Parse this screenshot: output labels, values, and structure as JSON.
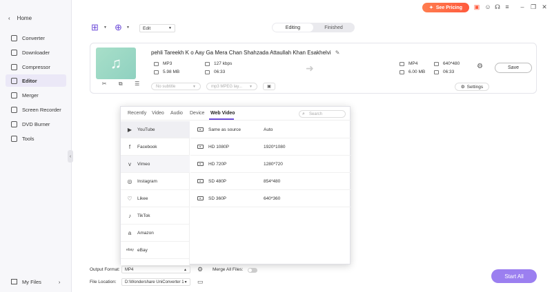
{
  "sidebar": {
    "home_label": "Home",
    "items": [
      {
        "label": "Converter",
        "icon": "converter-icon"
      },
      {
        "label": "Downloader",
        "icon": "downloader-icon"
      },
      {
        "label": "Compressor",
        "icon": "compressor-icon"
      },
      {
        "label": "Editor",
        "icon": "editor-icon"
      },
      {
        "label": "Merger",
        "icon": "merger-icon"
      },
      {
        "label": "Screen Recorder",
        "icon": "screen-recorder-icon"
      },
      {
        "label": "DVD Burner",
        "icon": "dvd-burner-icon"
      },
      {
        "label": "Tools",
        "icon": "tools-icon"
      }
    ],
    "active_item": "Editor",
    "my_files_label": "My Files"
  },
  "topbar": {
    "pricing_label": "See Pricing",
    "accent_color": "#ff5a3d"
  },
  "toolbar": {
    "edit_label": "Edit",
    "tabs": [
      "Editing",
      "Finished"
    ],
    "active_tab": "Editing"
  },
  "file": {
    "title": "pehli Tareekh K o Aay Ga Mera Chan Shahzada Attaullah Khan Esakhelvi",
    "source": {
      "format": "MP3",
      "bitrate": "127 kbps",
      "size": "5.98 MB",
      "duration": "06:33"
    },
    "target": {
      "format": "MP4",
      "resolution": "640*480",
      "size": "6.00 MB",
      "duration": "06:33"
    },
    "subtitle_placeholder": "No subtitle",
    "audio_track": "mp3 MPEG lay...",
    "save_label": "Save",
    "settings_label": "Settings"
  },
  "format_panel": {
    "tabs": [
      "Recently",
      "Video",
      "Audio",
      "Device",
      "Web Video"
    ],
    "active_tab": "Web Video",
    "search_placeholder": "Search",
    "platforms": [
      {
        "label": "YouTube",
        "icon": "youtube-icon"
      },
      {
        "label": "Facebook",
        "icon": "facebook-icon"
      },
      {
        "label": "Vimeo",
        "icon": "vimeo-icon"
      },
      {
        "label": "Instagram",
        "icon": "instagram-icon"
      },
      {
        "label": "Likee",
        "icon": "likee-icon"
      },
      {
        "label": "TikTok",
        "icon": "tiktok-icon"
      },
      {
        "label": "Amazon",
        "icon": "amazon-icon"
      },
      {
        "label": "eBay",
        "icon": "ebay-icon"
      }
    ],
    "selected_platform": "YouTube",
    "resolutions": [
      {
        "name": "Same as source",
        "dim": "Auto"
      },
      {
        "name": "HD 1080P",
        "dim": "1920*1080"
      },
      {
        "name": "HD 720P",
        "dim": "1280*720"
      },
      {
        "name": "SD 480P",
        "dim": "854*480"
      },
      {
        "name": "SD 360P",
        "dim": "640*360"
      }
    ]
  },
  "bottom": {
    "output_format_label": "Output Format:",
    "output_format_value": "MP4",
    "merge_label": "Merge All Files:",
    "file_location_label": "File Location:",
    "file_location_value": "D:\\Wondershare UniConverter 1",
    "start_all_label": "Start All",
    "start_color": "#9b7ff0"
  }
}
